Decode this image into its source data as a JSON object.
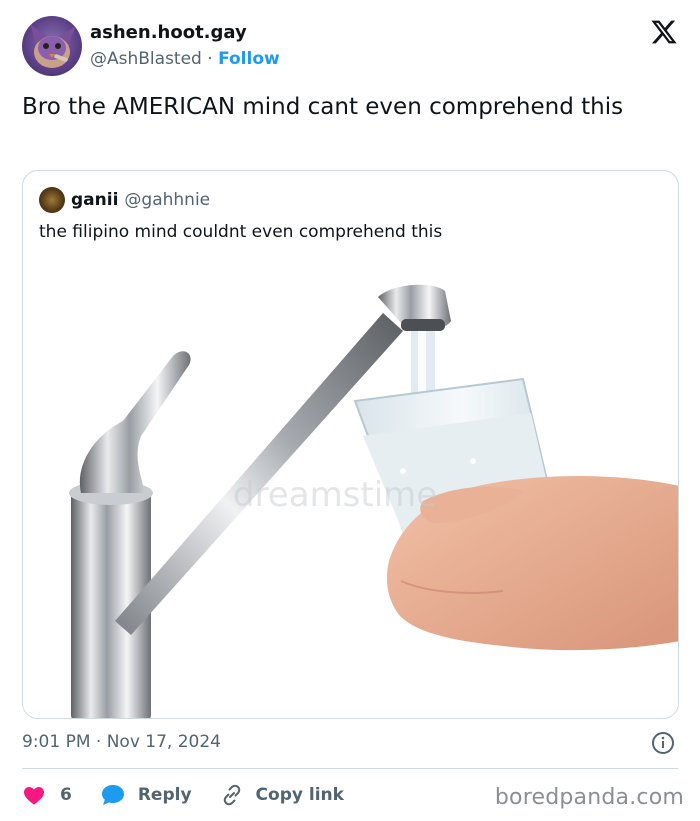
{
  "author": {
    "display_name": "ashen.hoot.gay",
    "handle": "@AshBlasted",
    "separator": "·",
    "follow_label": "Follow"
  },
  "tweet": {
    "text": "Bro the AMERICAN mind cant even comprehend this"
  },
  "quoted": {
    "name": "ganii",
    "handle": "@gahhnie",
    "text": "the filipino mind couldnt even comprehend this",
    "image_subject": "faucet filling a glass of water held by a hand",
    "watermark": "dreamstime"
  },
  "meta": {
    "timestamp": "9:01 PM · Nov 17, 2024"
  },
  "actions": {
    "like_count": "6",
    "reply_label": "Reply",
    "copy_label": "Copy link"
  },
  "site_watermark": "boredpanda.com",
  "colors": {
    "accent": "#1d9bf0",
    "like": "#f91880",
    "muted": "#536471",
    "border": "#cfd9de"
  },
  "icons": [
    "x-logo-icon",
    "info-icon",
    "heart-icon",
    "reply-bubble-icon",
    "link-icon"
  ]
}
